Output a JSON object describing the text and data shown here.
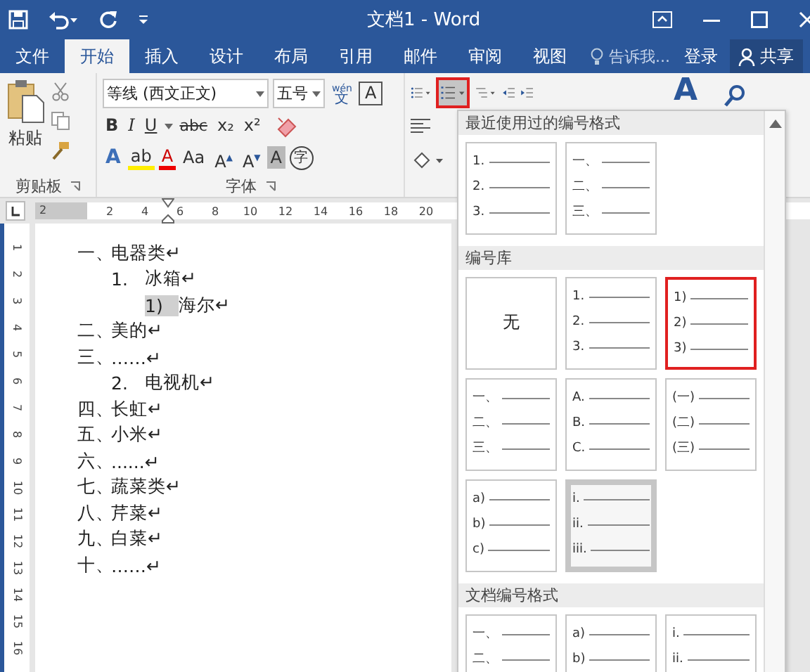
{
  "window": {
    "title": "文档1 - Word"
  },
  "tabs": [
    {
      "label": "文件",
      "selected": false
    },
    {
      "label": "开始",
      "selected": true
    },
    {
      "label": "插入",
      "selected": false
    },
    {
      "label": "设计",
      "selected": false
    },
    {
      "label": "布局",
      "selected": false
    },
    {
      "label": "引用",
      "selected": false
    },
    {
      "label": "邮件",
      "selected": false
    },
    {
      "label": "审阅",
      "selected": false
    },
    {
      "label": "视图",
      "selected": false
    }
  ],
  "tell_me": "告诉我...",
  "login": "登录",
  "share": "共享",
  "ribbon": {
    "clipboard": {
      "paste": "粘贴",
      "group_label": "剪贴板"
    },
    "font": {
      "font_name": "等线 (西文正文)",
      "font_size": "五号",
      "phonetic": "wén",
      "phonetic_char": "文",
      "char_border": "A",
      "bold": "B",
      "italic": "I",
      "underline": "U",
      "strike": "abc",
      "subscript": "x₂",
      "superscript": "x²",
      "effects": "A",
      "highlight": "ab",
      "font_color": "A",
      "case": "Aa",
      "grow": "A",
      "grow_arrow": "▲",
      "shrink": "A",
      "shrink_arrow": "▼",
      "shading": "A",
      "enclose": "字",
      "group_label": "字体"
    },
    "paragraph": {
      "numbering_button": {
        "selected": true,
        "marked": true
      }
    },
    "styles": {
      "glyph": "A"
    }
  },
  "ruler": {
    "left_number": "2",
    "numbers": [
      "2",
      "4",
      "6",
      "8",
      "10",
      "12",
      "14",
      "16",
      "18",
      "20"
    ],
    "vertical_numbers": [
      "1",
      "2",
      "3",
      "4",
      "5",
      "6",
      "7",
      "8",
      "9",
      "10",
      "11",
      "12",
      "13",
      "14",
      "15",
      "16"
    ]
  },
  "document": {
    "items": [
      {
        "marker": "一、",
        "text": "电器类↵",
        "highlighted": false,
        "children": [
          {
            "marker": "1.",
            "text": "冰箱↵",
            "highlighted": false,
            "children": [
              {
                "marker": "1)",
                "text": "海尔↵",
                "highlighted": true
              }
            ]
          }
        ]
      },
      {
        "marker": "二、",
        "text": "美的↵",
        "highlighted": false
      },
      {
        "marker": "三、",
        "text": "……↵",
        "highlighted": false,
        "children": [
          {
            "marker": "2.",
            "text": "电视机↵",
            "highlighted": false
          }
        ]
      },
      {
        "marker": "四、",
        "text": "长虹↵",
        "highlighted": false
      },
      {
        "marker": "五、",
        "text": "小米↵",
        "highlighted": false
      },
      {
        "marker": "六、",
        "text": "......↵",
        "highlighted": false
      },
      {
        "marker": "七、",
        "text": "蔬菜类↵",
        "highlighted": false
      },
      {
        "marker": "八、",
        "text": "芹菜↵",
        "highlighted": false
      },
      {
        "marker": "九、",
        "text": "白菜↵",
        "highlighted": false
      },
      {
        "marker": "十、",
        "text": "……↵",
        "highlighted": false
      }
    ]
  },
  "numbering_dropdown": {
    "sections": [
      {
        "title": "最近使用过的编号格式",
        "tiles": [
          {
            "kind": "list",
            "markers": [
              "1.",
              "2.",
              "3."
            ],
            "selected": false,
            "marked": false
          },
          {
            "kind": "list",
            "markers": [
              "一、",
              "二、",
              "三、"
            ],
            "selected": false,
            "marked": false
          }
        ]
      },
      {
        "title": "编号库",
        "tiles": [
          {
            "kind": "none",
            "label": "无",
            "selected": false,
            "marked": false
          },
          {
            "kind": "list",
            "markers": [
              "1.",
              "2.",
              "3."
            ],
            "selected": false,
            "marked": false
          },
          {
            "kind": "list",
            "markers": [
              "1)",
              "2)",
              "3)"
            ],
            "selected": false,
            "marked": true
          },
          {
            "kind": "list",
            "markers": [
              "一、",
              "二、",
              "三、"
            ],
            "selected": false,
            "marked": false
          },
          {
            "kind": "list",
            "markers": [
              "A.",
              "B.",
              "C."
            ],
            "selected": false,
            "marked": false
          },
          {
            "kind": "list",
            "markers": [
              "(一)",
              "(二)",
              "(三)"
            ],
            "selected": false,
            "marked": false
          },
          {
            "kind": "list",
            "markers": [
              "a)",
              "b)",
              "c)"
            ],
            "selected": false,
            "marked": false
          },
          {
            "kind": "list",
            "markers": [
              "i.",
              "ii.",
              "iii."
            ],
            "selected": true,
            "marked": false
          }
        ]
      },
      {
        "title": "文档编号格式",
        "tiles": [
          {
            "kind": "list",
            "markers": [
              "一、",
              "二、"
            ],
            "selected": false,
            "marked": false
          },
          {
            "kind": "list",
            "markers": [
              "a)",
              "b)"
            ],
            "selected": false,
            "marked": false
          },
          {
            "kind": "list",
            "markers": [
              "i.",
              "ii."
            ],
            "selected": false,
            "marked": false
          }
        ]
      }
    ]
  }
}
